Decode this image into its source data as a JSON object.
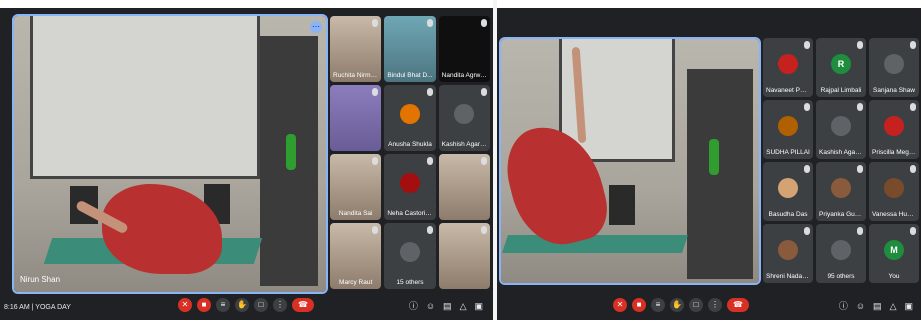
{
  "left": {
    "presenter_name": "Nirun Shan",
    "meeting_time": "8:16 AM",
    "meeting_title": "YOGA DAY",
    "tiles": [
      {
        "name": "Ruchita Nirmala",
        "kind": "video",
        "tone": "warm"
      },
      {
        "name": "Bindul Bhat D...",
        "kind": "video",
        "tone": "cool"
      },
      {
        "name": "Nandita Agrwa...",
        "kind": "video",
        "tone": "dark"
      },
      {
        "name": "",
        "kind": "video",
        "tone": "violet"
      },
      {
        "name": "Anusha Shukla",
        "kind": "avatar",
        "color": "#e37400",
        "initial": ""
      },
      {
        "name": "Kashish Agarwal",
        "kind": "avatar",
        "color": "#5f6368",
        "initial": ""
      },
      {
        "name": "Nandita Sai",
        "kind": "video",
        "tone": "warm"
      },
      {
        "name": "Neha Castoriyo...",
        "kind": "avatar",
        "color": "#a50e0e",
        "initial": ""
      },
      {
        "name": "",
        "kind": "video",
        "tone": "warm"
      },
      {
        "name": "Marcy Raut",
        "kind": "video",
        "tone": "warm"
      },
      {
        "name": "15 others",
        "kind": "avatar",
        "color": "#5f6368",
        "initial": ""
      },
      {
        "name": "",
        "kind": "video",
        "tone": "warm"
      }
    ]
  },
  "right": {
    "tiles": [
      {
        "name": "Navaneet Pers...",
        "kind": "avatar",
        "color": "#c5221f",
        "initial": ""
      },
      {
        "name": "Rajpal Limbali",
        "kind": "avatar",
        "color": "#1e8e3e",
        "initial": "R"
      },
      {
        "name": "Sanjana Shaw",
        "kind": "avatar",
        "color": "#5f6368",
        "initial": ""
      },
      {
        "name": "SUDHA PILLAI",
        "kind": "avatar",
        "color": "#b06000",
        "initial": ""
      },
      {
        "name": "Kashish Agarwal",
        "kind": "avatar",
        "color": "#5f6368",
        "initial": ""
      },
      {
        "name": "Priscilla Meghn...",
        "kind": "avatar",
        "color": "#c5221f",
        "initial": ""
      },
      {
        "name": "Basudha Das",
        "kind": "avatar",
        "color": "#d4a373",
        "initial": ""
      },
      {
        "name": "Priyanka Gupta",
        "kind": "avatar",
        "color": "#8a5a3c",
        "initial": ""
      },
      {
        "name": "Vanessa Hua R...",
        "kind": "avatar",
        "color": "#7a4b2a",
        "initial": ""
      },
      {
        "name": "Shreni Nadaba g...",
        "kind": "avatar",
        "color": "#8a5a3c",
        "initial": ""
      },
      {
        "name": "95 others",
        "kind": "avatar",
        "color": "#5f6368",
        "initial": ""
      },
      {
        "name": "You",
        "kind": "avatar",
        "color": "#1e8e3e",
        "initial": "M"
      }
    ]
  },
  "controls": {
    "left_icons": [
      "mic-off-icon",
      "camera-off-icon",
      "captions-icon",
      "raise-hand-icon",
      "present-icon",
      "more-icon",
      "hangup-icon"
    ],
    "right_icons": [
      "info-icon",
      "people-icon",
      "chat-icon",
      "activities-icon",
      "lock-icon"
    ]
  },
  "colors": {
    "meet_bg": "#202124",
    "tile_bg": "#3c4043",
    "danger": "#d93025",
    "accent": "#8ab4f8"
  }
}
